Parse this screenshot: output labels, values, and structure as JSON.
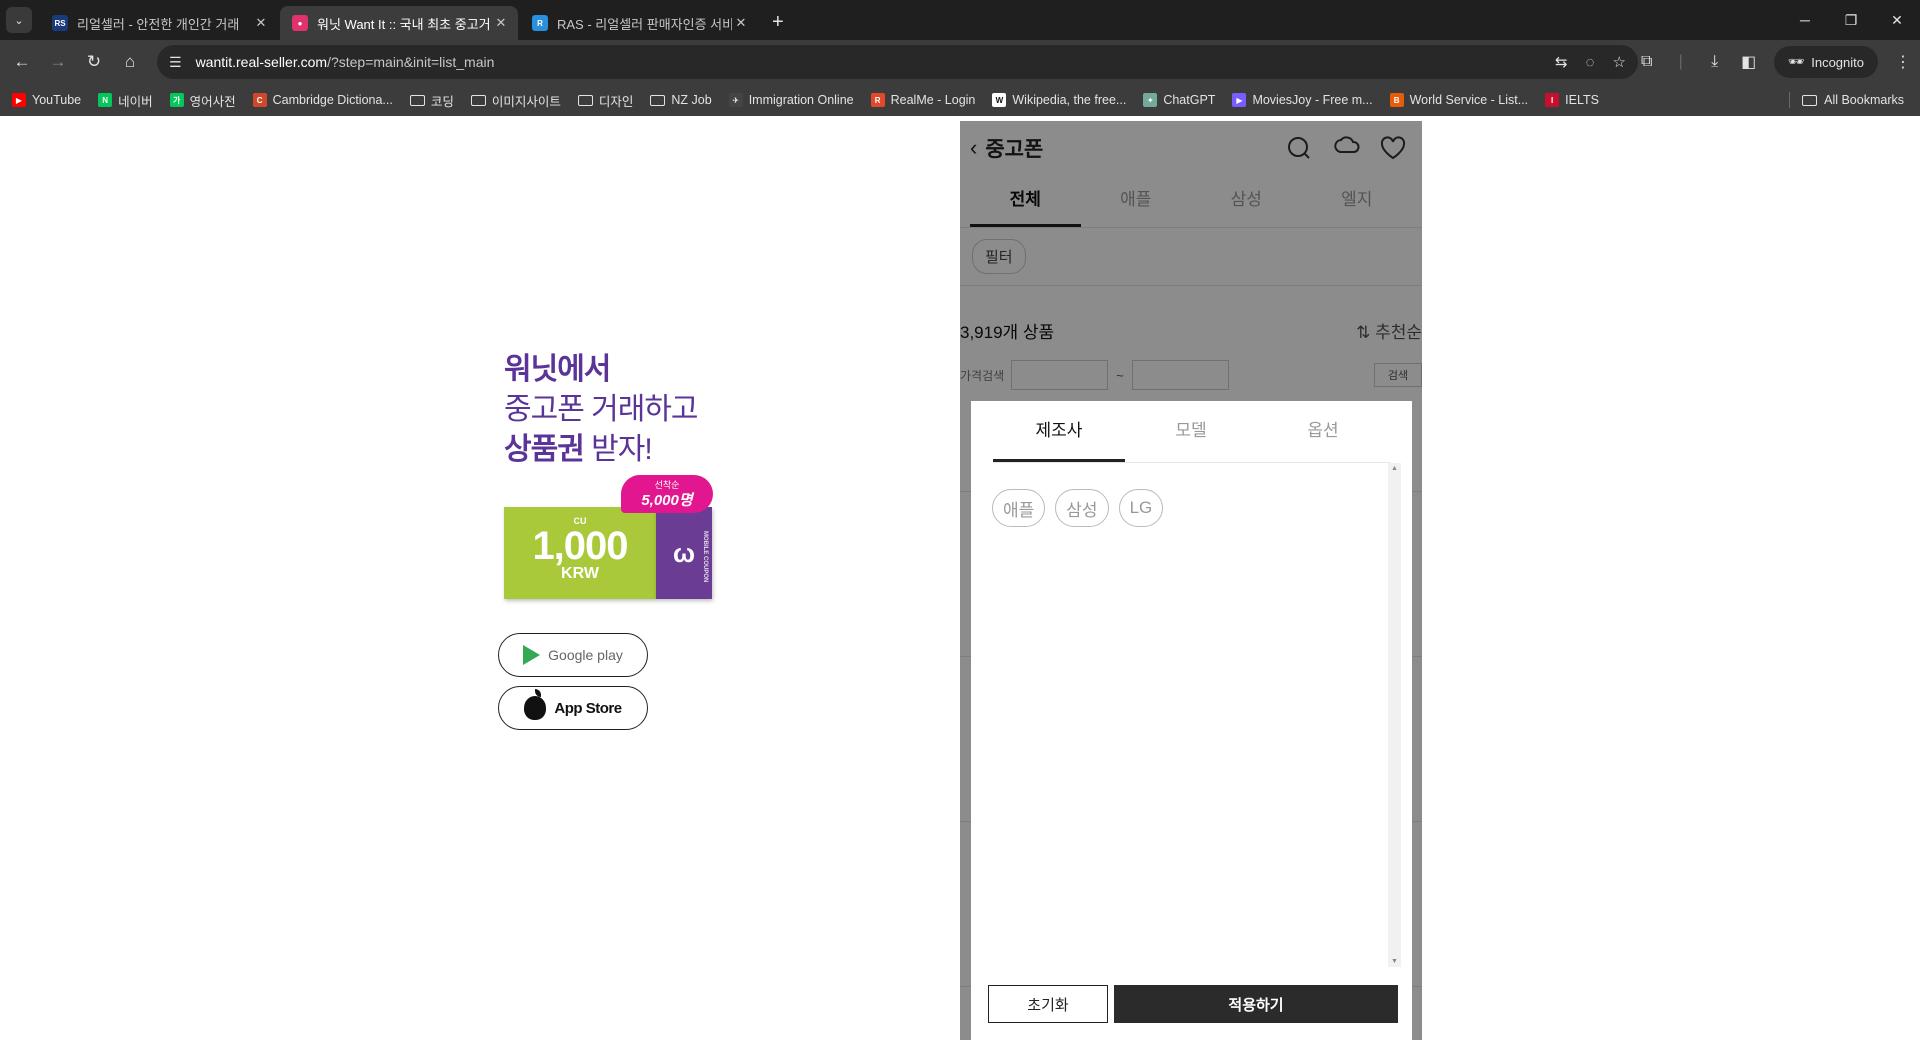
{
  "browser": {
    "tabs": [
      {
        "favicon": "RS",
        "favicon_color": "#1a3a7a",
        "title": "리얼셀러 - 안전한 개인간 거래",
        "active": false
      },
      {
        "favicon": "●",
        "favicon_color": "#e0336e",
        "title": "워닛 Want It :: 국내 최초 중고거",
        "active": true
      },
      {
        "favicon": "R",
        "favicon_color": "#2a8fdc",
        "title": "RAS - 리얼셀러 판매자인증 서비",
        "active": false
      }
    ],
    "url_host": "wantit.real-seller.com",
    "url_path": "/?step=main&init=list_main",
    "incognito_label": "Incognito",
    "bookmarks": [
      {
        "label": "YouTube",
        "icon": "youtube-icon",
        "color": "#ff0000",
        "glyph": "▶"
      },
      {
        "label": "네이버",
        "icon": "naver-icon",
        "color": "#03c75a",
        "glyph": "N"
      },
      {
        "label": "영어사전",
        "icon": "naver-dict-icon",
        "color": "#03c75a",
        "glyph": "가"
      },
      {
        "label": "Cambridge Dictiona...",
        "icon": "cambridge-icon",
        "color": "#d0482b",
        "glyph": "C"
      },
      {
        "label": "코딩",
        "icon": "folder-icon",
        "folder": true
      },
      {
        "label": "이미지사이트",
        "icon": "folder-icon",
        "folder": true
      },
      {
        "label": "디자인",
        "icon": "folder-icon",
        "folder": true
      },
      {
        "label": "NZ Job",
        "icon": "folder-icon",
        "folder": true
      },
      {
        "label": "Immigration Online",
        "icon": "immigration-icon",
        "color": "#444",
        "glyph": "✈"
      },
      {
        "label": "RealMe - Login",
        "icon": "realme-icon",
        "color": "#e2492a",
        "glyph": "R"
      },
      {
        "label": "Wikipedia, the free...",
        "icon": "wikipedia-icon",
        "color": "#fff",
        "glyph": "W",
        "dark": true
      },
      {
        "label": "ChatGPT",
        "icon": "chatgpt-icon",
        "color": "#74aa9c",
        "glyph": "✦"
      },
      {
        "label": "MoviesJoy - Free m...",
        "icon": "moviesjoy-icon",
        "color": "#7b5cff",
        "glyph": "▶"
      },
      {
        "label": "World Service - List...",
        "icon": "bbc-icon",
        "color": "#e85d0c",
        "glyph": "B"
      },
      {
        "label": "IELTS",
        "icon": "ielts-icon",
        "color": "#c8102e",
        "glyph": "I"
      }
    ],
    "all_bookmarks_label": "All Bookmarks"
  },
  "promo": {
    "line1": "워닛에서",
    "line2": "중고폰 거래하고",
    "line3_bold": "상품권",
    "line3_rest": " 받자!",
    "coupon_brand": "CU",
    "coupon_amount": "1,000",
    "coupon_currency": "KRW",
    "coupon_side_text": "MOBILE COUPON",
    "badge_small": "선착순",
    "badge_big": "5,000명",
    "google_play_label": "Google play",
    "app_store_label": "App Store"
  },
  "app": {
    "title": "중고폰",
    "category_tabs": [
      "전체",
      "애플",
      "삼성",
      "엘지"
    ],
    "active_category": 0,
    "filter_chip": "필터",
    "product_count": "3,919개 상품",
    "sort_label": "추천순",
    "price_search_label": "가격검색",
    "price_separator": "~",
    "search_button": "검색"
  },
  "filter_sheet": {
    "tabs": [
      "제조사",
      "모델",
      "옵션"
    ],
    "active_tab": 0,
    "brands": [
      "애플",
      "삼성",
      "LG"
    ],
    "reset_label": "초기화",
    "apply_label": "적용하기"
  }
}
